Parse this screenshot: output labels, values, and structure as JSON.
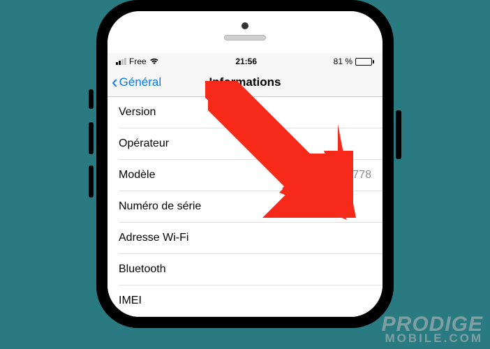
{
  "status": {
    "carrier": "Free",
    "time": "21:56",
    "battery_pct": "81 %"
  },
  "nav": {
    "back_label": "Général",
    "title": "Informations"
  },
  "rows": {
    "version": {
      "label": "Version",
      "value": ""
    },
    "operator": {
      "label": "Opérateur",
      "value": ""
    },
    "model": {
      "label": "Modèle",
      "value": "A1778"
    },
    "serial": {
      "label": "Numéro de série",
      "value": ""
    },
    "wifi": {
      "label": "Adresse Wi-Fi",
      "value": ""
    },
    "bluetooth": {
      "label": "Bluetooth",
      "value": ""
    },
    "imei": {
      "label": "IMEI",
      "value": ""
    }
  },
  "watermark": {
    "line1": "PRODIGE",
    "line2": "MOBILE.COM"
  }
}
